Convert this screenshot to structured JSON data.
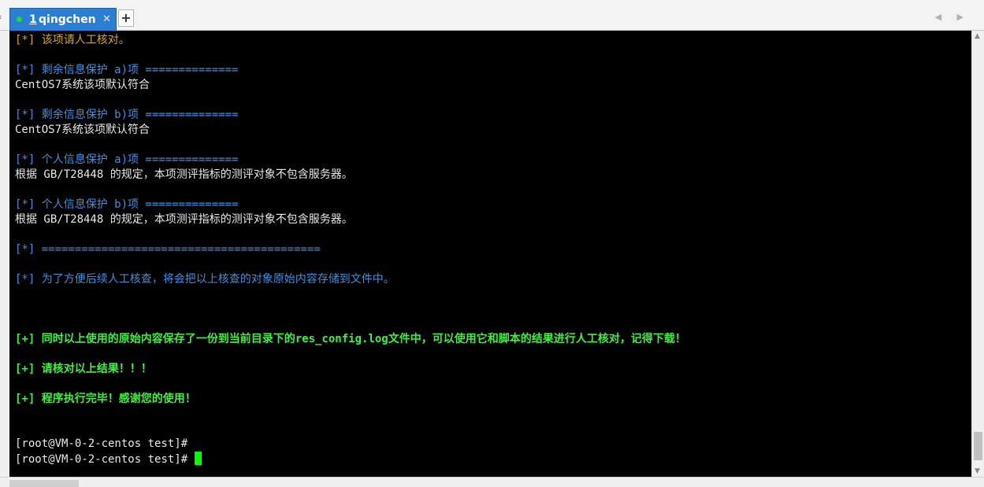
{
  "tabbar": {
    "left_arrow": "‹",
    "tab": {
      "number": "1",
      "title": "qingchen",
      "close": "✕"
    },
    "add_label": "+",
    "nav_arrows": "◀ ▶"
  },
  "terminal": {
    "lines": [
      {
        "text": "[*] 该项请人工核对。",
        "color": "yellow"
      },
      {
        "text": "",
        "color": "white"
      },
      {
        "text": "[*] 剩余信息保护 a)项 ==============",
        "color": "blue"
      },
      {
        "text": "CentOS7系统该项默认符合",
        "color": "white"
      },
      {
        "text": "",
        "color": "white"
      },
      {
        "text": "[*] 剩余信息保护 b)项 ==============",
        "color": "blue"
      },
      {
        "text": "CentOS7系统该项默认符合",
        "color": "white"
      },
      {
        "text": "",
        "color": "white"
      },
      {
        "text": "[*] 个人信息保护 a)项 ==============",
        "color": "blue"
      },
      {
        "text": "根据 GB/T28448 的规定，本项测评指标的测评对象不包含服务器。",
        "color": "white"
      },
      {
        "text": "",
        "color": "white"
      },
      {
        "text": "[*] 个人信息保护 b)项 ==============",
        "color": "blue"
      },
      {
        "text": "根据 GB/T28448 的规定，本项测评指标的测评对象不包含服务器。",
        "color": "white"
      },
      {
        "text": "",
        "color": "white"
      },
      {
        "text": "[*] ==========================================",
        "color": "blue"
      },
      {
        "text": "",
        "color": "white"
      },
      {
        "text": "[*] 为了方便后续人工核查，将会把以上核查的对象原始内容存储到文件中。",
        "color": "blue"
      },
      {
        "text": "",
        "color": "white"
      },
      {
        "text": "",
        "color": "white"
      },
      {
        "text": "",
        "color": "white"
      },
      {
        "text": "[+] 同时以上使用的原始内容保存了一份到当前目录下的res_config.log文件中，可以使用它和脚本的结果进行人工核对，记得下载！",
        "color": "green"
      },
      {
        "text": "",
        "color": "white"
      },
      {
        "text": "[+] 请核对以上结果！！！",
        "color": "green"
      },
      {
        "text": "",
        "color": "white"
      },
      {
        "text": "[+] 程序执行完毕！感谢您的使用！",
        "color": "green"
      },
      {
        "text": "",
        "color": "white"
      },
      {
        "text": "",
        "color": "white"
      },
      {
        "text": "[root@VM-0-2-centos test]#",
        "color": "white"
      }
    ],
    "prompt": "[root@VM-0-2-centos test]# "
  }
}
